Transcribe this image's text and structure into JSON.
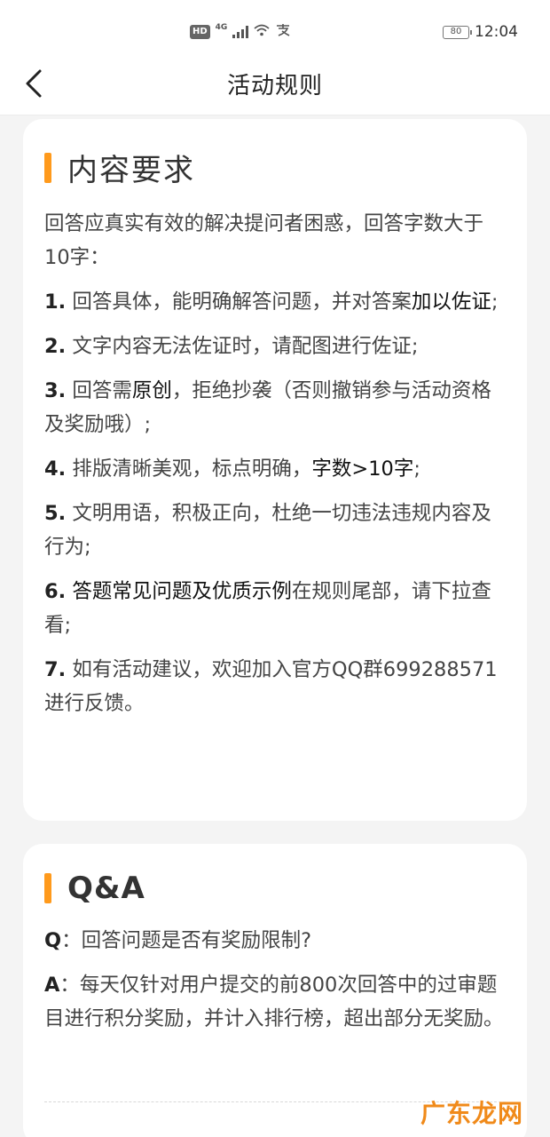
{
  "status_bar": {
    "hd": "HD",
    "network": "4G",
    "wifi_icon": "wifi-icon",
    "pay_icon": "alipay-icon",
    "battery": "80",
    "time": "12:04"
  },
  "nav": {
    "back_icon": "chevron-left-icon",
    "title": "活动规则"
  },
  "content_requirements": {
    "title": "内容要求",
    "intro": "回答应真实有效的解决提问者困惑，回答字数大于10字：",
    "rules": [
      {
        "num": "1.",
        "parts": [
          {
            "t": " 回答具体，能明确解答问题，并对答案"
          },
          {
            "t": "加以佐证",
            "strong": true
          },
          {
            "t": ";"
          }
        ]
      },
      {
        "num": "2.",
        "parts": [
          {
            "t": " 文字内容无法佐证时，请配图进行佐证;"
          }
        ]
      },
      {
        "num": "3.",
        "parts": [
          {
            "t": " 回答需"
          },
          {
            "t": "原创",
            "strong": true
          },
          {
            "t": "，拒绝抄袭（否则撤销参与活动资格及奖励哦）;"
          }
        ]
      },
      {
        "num": "4.",
        "parts": [
          {
            "t": " 排版清晰美观，标点明确，"
          },
          {
            "t": "字数>10字",
            "strong": true
          },
          {
            "t": ";"
          }
        ]
      },
      {
        "num": "5.",
        "parts": [
          {
            "t": " 文明用语，积极正向，杜绝一切违法违规内容及行为;"
          }
        ]
      },
      {
        "num": "6.",
        "parts": [
          {
            "t": " 答题常见问题及优质示例",
            "strong": true
          },
          {
            "t": "在规则尾部，请下拉查看;"
          }
        ]
      },
      {
        "num": "7.",
        "parts": [
          {
            "t": " 如有活动建议，欢迎加入官方QQ群699288571进行反馈。"
          }
        ]
      }
    ]
  },
  "qa": {
    "title": "Q&A",
    "q_prefix": "Q",
    "q_text": "：回答问题是否有奖励限制?",
    "a_prefix": "A",
    "a_text": "：每天仅针对用户提交的前800次回答中的过审题目进行积分奖励，并计入排行榜，超出部分无奖励。"
  },
  "watermark": "广东龙网",
  "colors": {
    "accent": "#ff9a1c",
    "background": "#f4f4f4",
    "card": "#ffffff"
  }
}
